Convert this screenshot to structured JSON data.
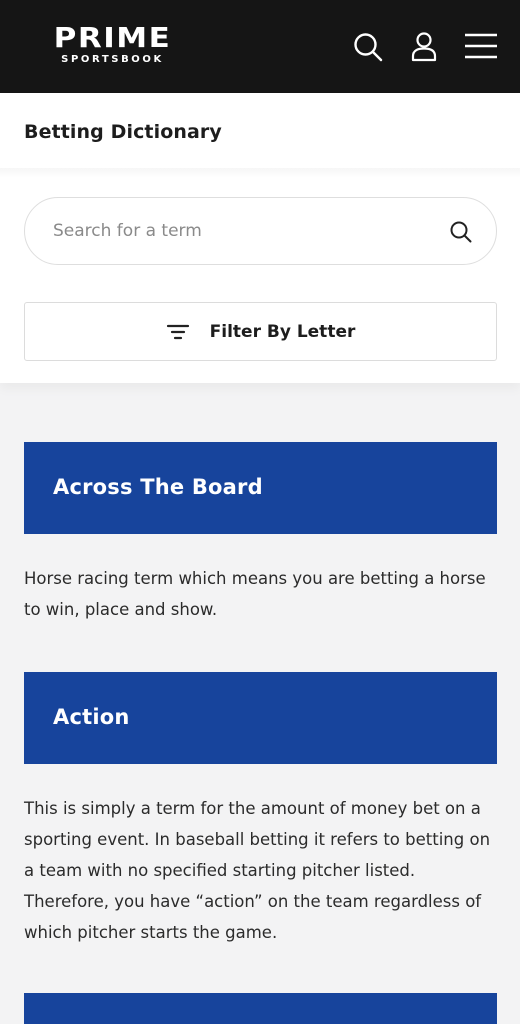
{
  "header": {
    "logo_main": "PRIME",
    "logo_sub": "SPORTSBOOK",
    "icons": [
      "search-icon",
      "user-icon",
      "menu-icon"
    ]
  },
  "page": {
    "title": "Betting Dictionary"
  },
  "search": {
    "placeholder": "Search for a term",
    "value": ""
  },
  "filter": {
    "label": "Filter By Letter"
  },
  "terms": [
    {
      "term": "Across The Board",
      "definition": "Horse racing term which means you are betting a horse to win, place and show."
    },
    {
      "term": "Action",
      "definition": "This is simply a term for the amount of money bet on a sporting event. In baseball betting it refers to betting on a team with no specified starting pitcher listed. Therefore, you have “action” on the team regardless of which pitcher starts the game."
    },
    {
      "term": "",
      "definition": ""
    }
  ],
  "colors": {
    "topbar": "#151515",
    "term_header": "#17449c",
    "page_bg": "#f3f3f4"
  }
}
